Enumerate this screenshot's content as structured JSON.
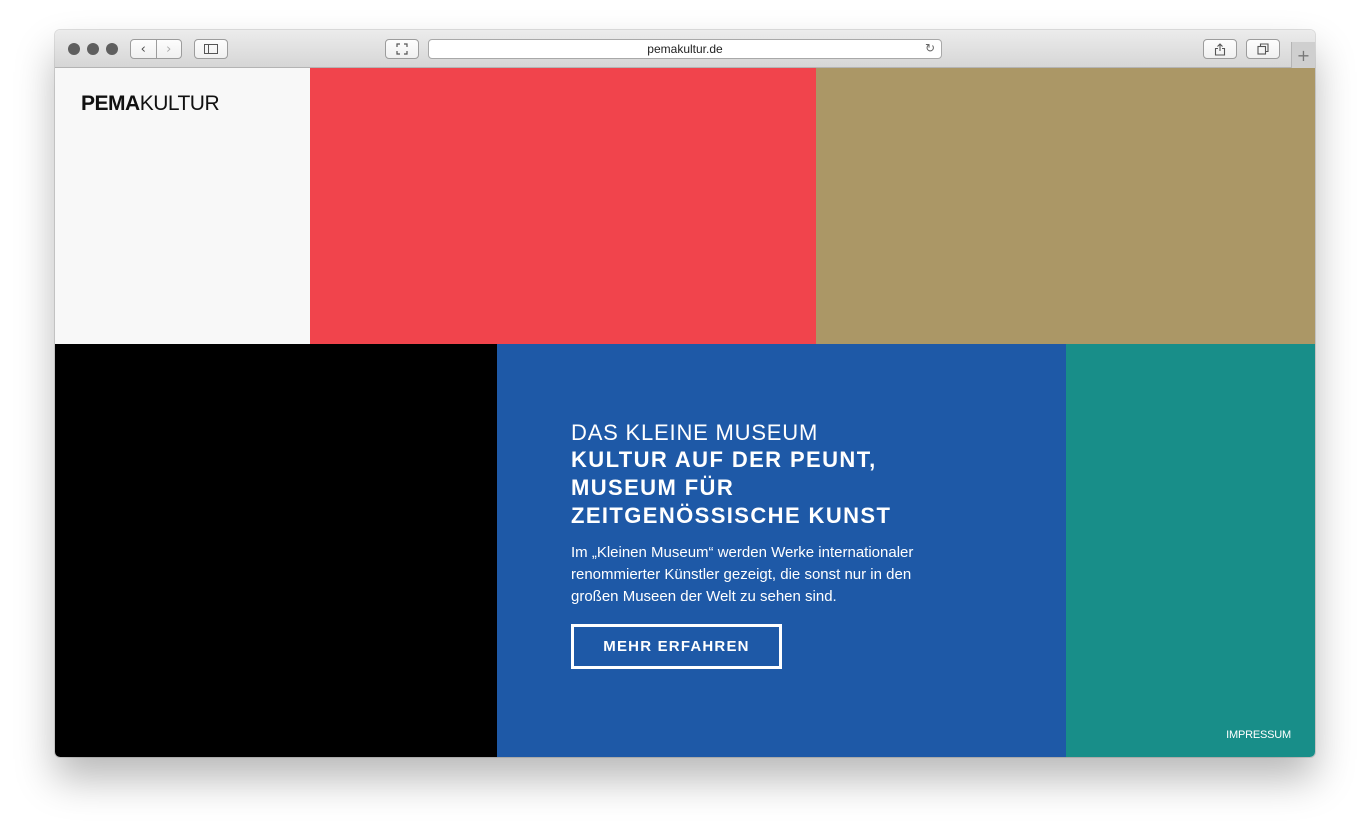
{
  "browser": {
    "url": "pemakultur.de",
    "back_glyph": "‹",
    "forward_glyph": "›",
    "reload_glyph": "↻",
    "new_tab_glyph": "+",
    "icons": [
      "back-icon",
      "forward-icon",
      "sidebar-icon",
      "fullscreen-icon",
      "reload-icon",
      "share-icon",
      "tabs-icon",
      "new-tab-icon"
    ]
  },
  "logo": {
    "bold": "PEMA",
    "regular": "KULTUR"
  },
  "tiles": {
    "logo_tile": "#f8f8f8",
    "red": "#f1444c",
    "gold": "#ab9766",
    "black": "#000000",
    "blue": "#1e59a7",
    "teal": "#188e89"
  },
  "hero": {
    "kicker": "DAS KLEINE MUSEUM",
    "title_lines": [
      "KULTUR AUF DER PEUNT,",
      "MUSEUM FÜR",
      "ZEITGENÖSSISCHE KUNST"
    ],
    "description_lines": [
      "Im „Kleinen Museum“ werden Werke internationaler",
      "renommierter Künstler gezeigt, die sonst nur in den",
      "großen Museen der Welt zu sehen sind."
    ],
    "cta_label": "MEHR ERFAHREN"
  },
  "footer": {
    "impressum_label": "IMPRESSUM"
  }
}
